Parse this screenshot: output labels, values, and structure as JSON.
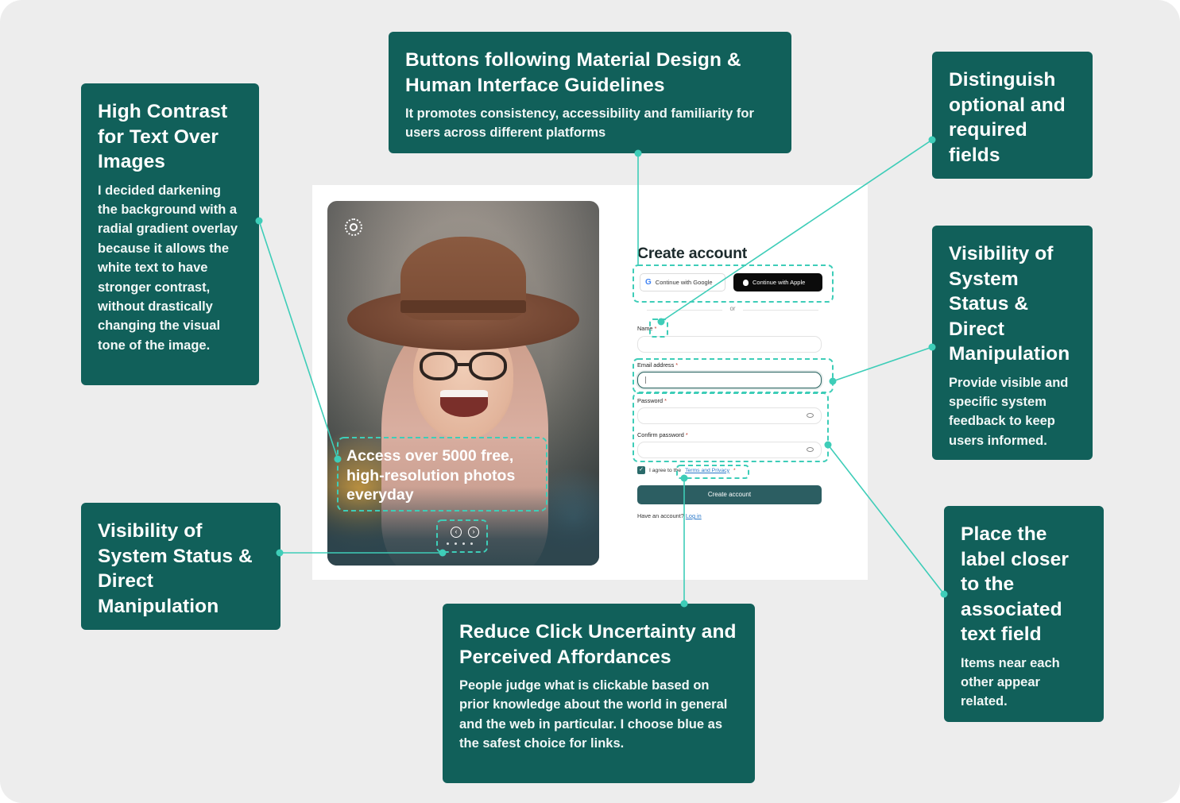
{
  "annotations": {
    "high_contrast": {
      "title": "High Contrast for Text Over Images",
      "body": "I decided darkening the background with a radial gradient overlay because it allows the white text to have stronger contrast, without drastically changing the visual tone of the image."
    },
    "buttons_guidelines": {
      "title": "Buttons following Material Design & Human Interface Guidelines",
      "body": "It promotes consistency, accessibility and familiarity for users across different platforms"
    },
    "optional_required": {
      "title": "Distinguish optional and required fields"
    },
    "visibility_right": {
      "title": "Visibility of System Status & Direct Manipulation",
      "body": "Provide visible and specific system feedback to keep users informed."
    },
    "visibility_left": {
      "title": "Visibility of System Status & Direct Manipulation"
    },
    "click_uncertainty": {
      "title": "Reduce Click Uncertainty and Perceived Affordances",
      "body": "People judge what is clickable based on prior knowledge about the world in general and the web in particular. I choose blue as the safest choice for links."
    },
    "label_closer": {
      "title": "Place the label closer to the associated text field",
      "body": "Items near each other appear related."
    }
  },
  "mockup": {
    "photo_headline": "Access over 5000 free, high-resolution photos everyday",
    "nav_prev": "‹",
    "nav_next": "›",
    "form": {
      "title": "Create account",
      "google_label": "Continue with Google",
      "apple_label": "Continue with Apple",
      "or_label": "or",
      "name_label": "Name",
      "email_label": "Email address",
      "password_label": "Password",
      "confirm_label": "Confirm password",
      "required_mark": "*",
      "agree_prefix": "I agree to the",
      "agree_link": "Terms and Privacy",
      "create_button": "Create account",
      "have_account": "Have an account?",
      "login_link": "Log in"
    }
  },
  "colors": {
    "card": "#11605a",
    "connector": "#3ecdb8",
    "background": "#ededed",
    "link": "#2a78c9",
    "primary_button": "#2c5e62"
  }
}
